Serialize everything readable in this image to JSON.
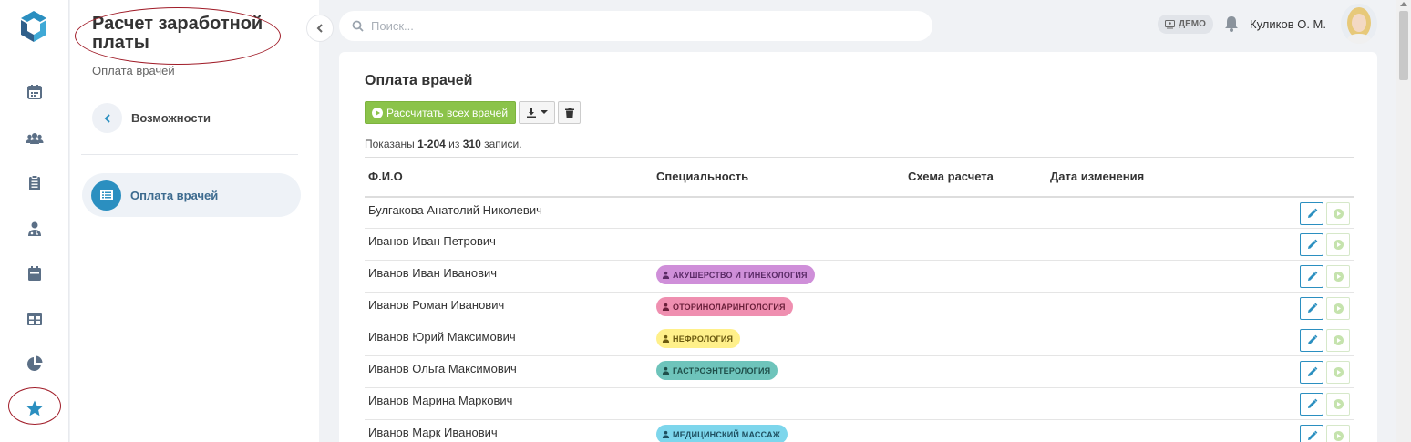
{
  "panel": {
    "title": "Расчет заработной платы",
    "subtitle": "Оплата врачей",
    "back_label": "Возможности",
    "active_item": "Оплата врачей"
  },
  "topbar": {
    "search_placeholder": "Поиск...",
    "demo_badge": "ДЕМО",
    "user_name": "Куликов О. М."
  },
  "card": {
    "title": "Оплата врачей",
    "calc_all_button": "Рассчитать всех врачей",
    "summary": {
      "prefix": "Показаны",
      "range": "1-204",
      "of": "из",
      "total": "310",
      "suffix": "записи."
    }
  },
  "table": {
    "columns": [
      "Ф.И.О",
      "Специальность",
      "Схема расчета",
      "Дата изменения"
    ],
    "rows": [
      {
        "name": "Булгакова Анатолий Николевич",
        "specialty": ""
      },
      {
        "name": "Иванов Иван Петрович",
        "specialty": ""
      },
      {
        "name": "Иванов Иван Иванович",
        "specialty": "АКУШЕРСТВО И ГИНЕКОЛОГИЯ"
      },
      {
        "name": "Иванов Роман Иванович",
        "specialty": "ОТОРИНОЛАРИНГОЛОГИЯ"
      },
      {
        "name": "Иванов Юрий Максимович",
        "specialty": "НЕФРОЛОГИЯ"
      },
      {
        "name": "Иванов Ольга Максимович",
        "specialty": "ГАСТРОЭНТЕРОЛОГИЯ"
      },
      {
        "name": "Иванов Марина Маркович",
        "specialty": ""
      },
      {
        "name": "Иванов Марк Иванович",
        "specialty": "МЕДИЦИНСКИЙ МАССАЖ"
      }
    ]
  },
  "colors": {
    "accent": "#2b8fc0",
    "green": "#8bc34a",
    "annotation": "#a01c28",
    "tag_purple": "#cf8fd9",
    "tag_pink": "#ef8fb0",
    "tag_yellow": "#fff08a",
    "tag_teal": "#6ec4bb",
    "tag_cyan": "#7dd6ec"
  },
  "icons": {
    "rail": [
      "calendar-icon",
      "users-icon",
      "clipboard-icon",
      "doctor-icon",
      "schedule-icon",
      "table-icon",
      "pie-chart-icon",
      "star-icon"
    ]
  }
}
